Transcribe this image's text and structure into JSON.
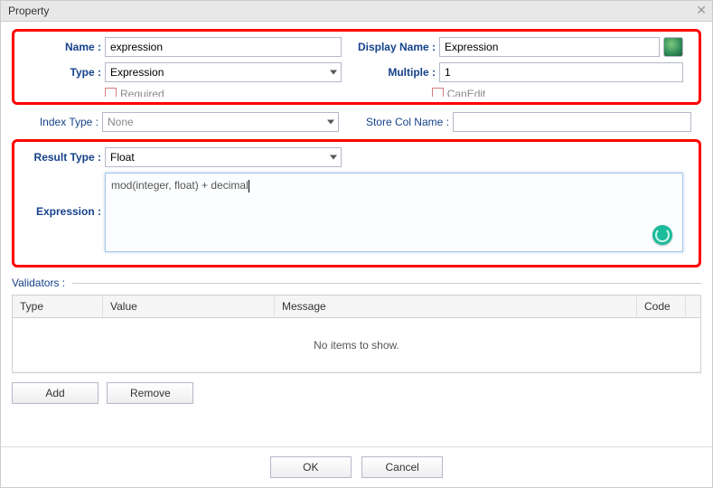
{
  "dialog": {
    "title": "Property"
  },
  "form": {
    "name": {
      "label": "Name :",
      "value": "expression"
    },
    "displayName": {
      "label": "Display Name :",
      "value": "Expression"
    },
    "type": {
      "label": "Type :",
      "value": "Expression"
    },
    "multiple": {
      "label": "Multiple :",
      "value": "1"
    },
    "required": {
      "label": "Required"
    },
    "canEdit": {
      "label": "CanEdit"
    },
    "indexType": {
      "label": "Index Type :",
      "value": "None"
    },
    "storeColName": {
      "label": "Store Col Name :",
      "value": ""
    },
    "resultType": {
      "label": "Result Type :",
      "value": "Float"
    },
    "expression": {
      "label": "Expression :",
      "value": "mod(integer, float) + decimal"
    }
  },
  "validators": {
    "label": "Validators :",
    "columns": {
      "type": "Type",
      "value": "Value",
      "message": "Message",
      "code": "Code"
    },
    "empty": "No items to show."
  },
  "buttons": {
    "add": "Add",
    "remove": "Remove",
    "ok": "OK",
    "cancel": "Cancel"
  }
}
